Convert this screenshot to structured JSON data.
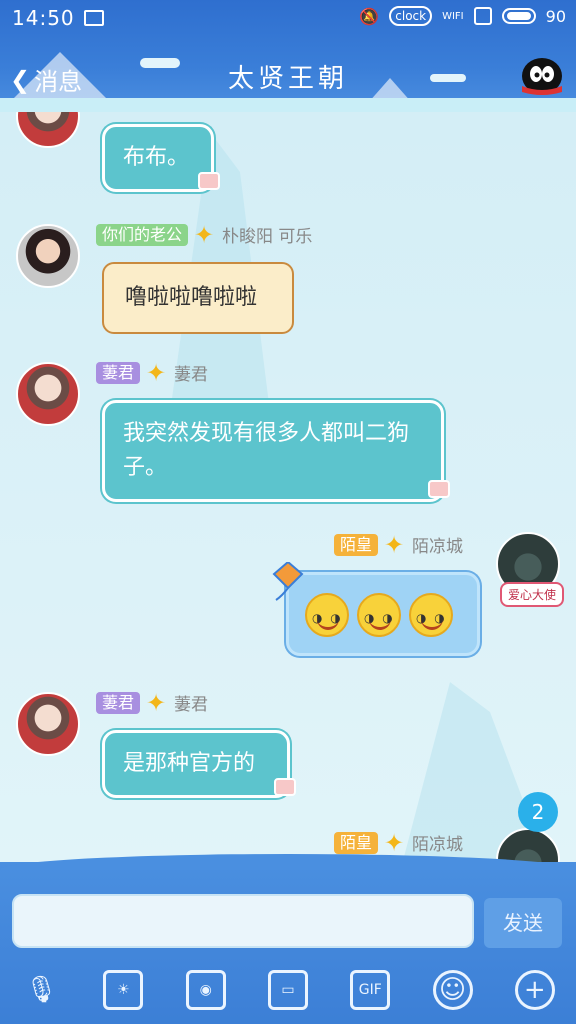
{
  "status": {
    "time": "14:50",
    "clock_label": "clock",
    "wifi_label": "WIFI",
    "battery": "90"
  },
  "header": {
    "back_label": "消息",
    "title": "太贤王朝"
  },
  "messages": [
    {
      "text": "布布。"
    },
    {
      "tag": "你们的老公",
      "sender": "朴睃阳  可乐",
      "text": "噜啦啦噜啦啦"
    },
    {
      "tag": "萋君",
      "sender": "萋君",
      "text": "我突然发现有很多人都叫二狗子。"
    },
    {
      "tag": "陌皇",
      "sender": "陌凉城",
      "emoji_count": 3,
      "badge": "爱心大使"
    },
    {
      "tag": "萋君",
      "sender": "萋君",
      "text": "是那种官方的"
    },
    {
      "tag": "陌皇",
      "sender": "陌凉城"
    }
  ],
  "unread_count": "2",
  "input": {
    "send_label": "发送",
    "gif_label": "GIF"
  }
}
